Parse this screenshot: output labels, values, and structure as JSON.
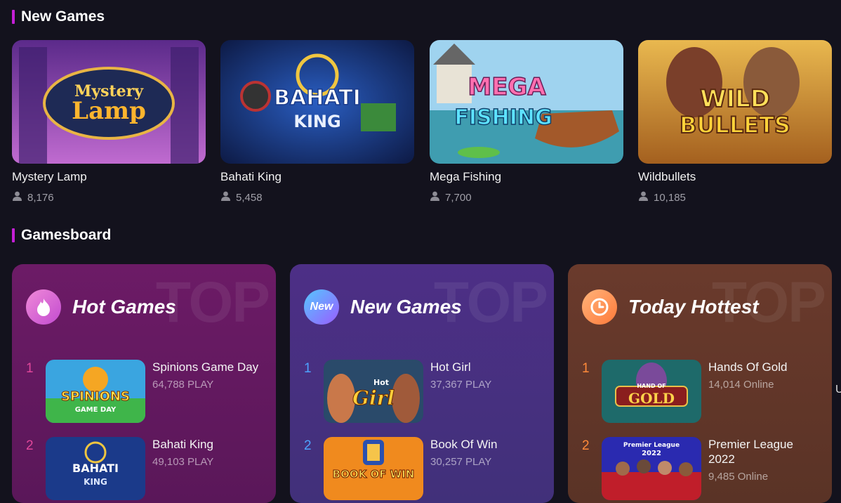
{
  "sections": {
    "new_games_title": "New Games",
    "gamesboard_title": "Gamesboard"
  },
  "new_games": [
    {
      "name": "Mystery Lamp",
      "players": "8,176",
      "art_line1": "Mystery",
      "art_line2": "Lamp"
    },
    {
      "name": "Bahati King",
      "players": "5,458",
      "art_line1": "BAHATI",
      "art_line2": "KING"
    },
    {
      "name": "Mega Fishing",
      "players": "7,700",
      "art_line1": "MEGA",
      "art_line2": "FISHING"
    },
    {
      "name": "Wildbullets",
      "players": "10,185",
      "art_line1": "WILD",
      "art_line2": "BULLETS"
    }
  ],
  "boards": [
    {
      "title": "Hot Games",
      "watermark": "TOP",
      "icon": "flame-icon",
      "accent": "#e0479a",
      "items": [
        {
          "rank": "1",
          "name": "Spinions Game Day",
          "stat": "64,788 PLAY",
          "art_line1": "SPINIONS",
          "art_line2": "GAME DAY"
        },
        {
          "rank": "2",
          "name": "Bahati King",
          "stat": "49,103 PLAY",
          "art_line1": "BAHATI",
          "art_line2": "KING"
        }
      ]
    },
    {
      "title": "New Games",
      "watermark": "TOP",
      "icon": "new-badge-icon",
      "icon_text": "New",
      "accent": "#4da3ff",
      "items": [
        {
          "rank": "1",
          "name": "Hot Girl",
          "stat": "37,367 PLAY",
          "art_line1": "Hot",
          "art_line2": "Girl"
        },
        {
          "rank": "2",
          "name": "Book Of Win",
          "stat": "30,257 PLAY",
          "art_line1": "BOOK OF WIN",
          "art_line2": ""
        }
      ]
    },
    {
      "title": "Today Hottest",
      "watermark": "TOP",
      "icon": "clock-icon",
      "accent": "#ff8a3a",
      "items": [
        {
          "rank": "1",
          "name": "Hands Of Gold",
          "stat": "14,014 Online",
          "art_line1": "HAND OF",
          "art_line2": "GOLD"
        },
        {
          "rank": "2",
          "name": "Premier League 2022",
          "stat": "9,485 Online",
          "art_line1": "Premier League",
          "art_line2": "2022"
        }
      ]
    }
  ],
  "stray_text": "U",
  "colors": {
    "background": "#13121d",
    "section_accent": "#c41fd6",
    "muted_text": "#a09fa8"
  }
}
